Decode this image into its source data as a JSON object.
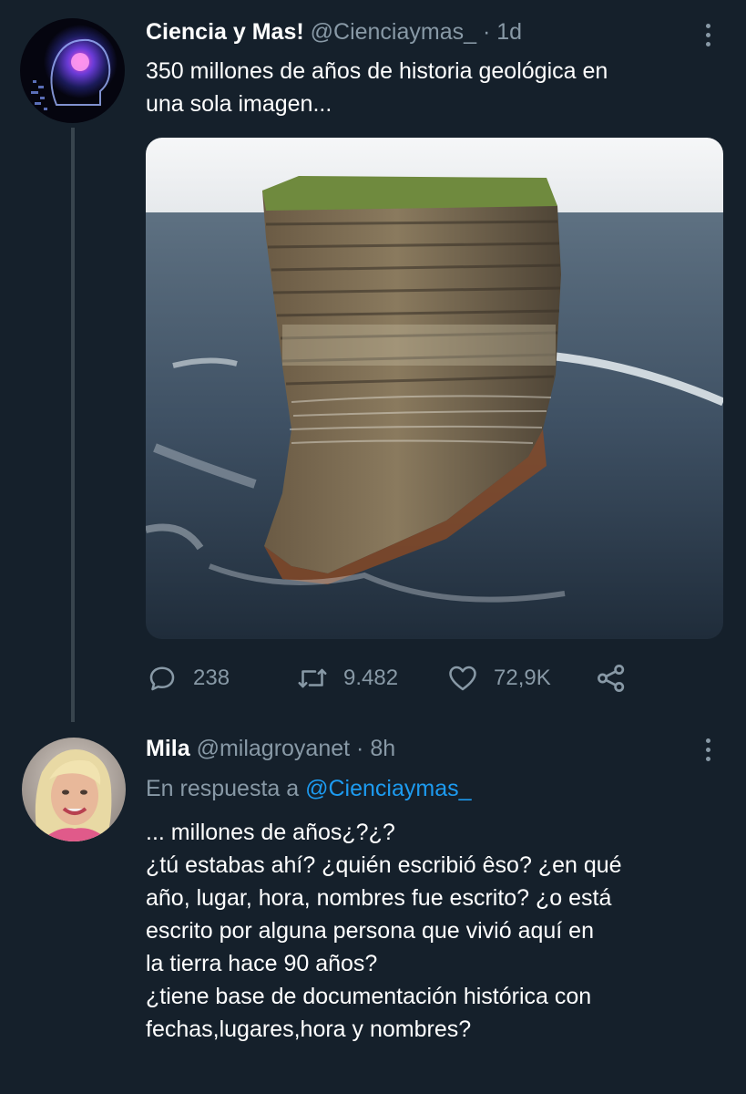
{
  "tweet": {
    "display_name": "Ciencia y Mas!",
    "handle": "@Cienciaymas_",
    "separator": "·",
    "time": "1d",
    "text_lines": [
      "350 millones de años de historia geológica en",
      "una sola imagen..."
    ],
    "stats": {
      "replies": "238",
      "retweets": "9.482",
      "likes": "72,9K"
    }
  },
  "reply": {
    "display_name": "Mila",
    "handle": "@milagroyanet",
    "separator": "·",
    "time": "8h",
    "replying_to_label": "En respuesta a",
    "replying_to_handle": "@Cienciaymas_",
    "text_lines": [
      "... millones de años¿?¿?",
      "¿tú estabas ahí? ¿quién escribió êso? ¿en qué",
      "año, lugar, hora, nombres fue escrito? ¿o está",
      "escrito por alguna persona que vivió aquí en",
      "la tierra hace 90 años?",
      "¿tiene base de documentación histórica con",
      "fechas,lugares,hora y nombres?"
    ]
  },
  "icons": {
    "reply": "speech-bubble-icon",
    "retweet": "retweet-icon",
    "like": "heart-icon",
    "share": "share-icon",
    "more": "more-vertical-icon"
  },
  "colors": {
    "background": "#15202b",
    "muted": "#8899a6",
    "link": "#1d9bf0",
    "line": "#38444d"
  }
}
